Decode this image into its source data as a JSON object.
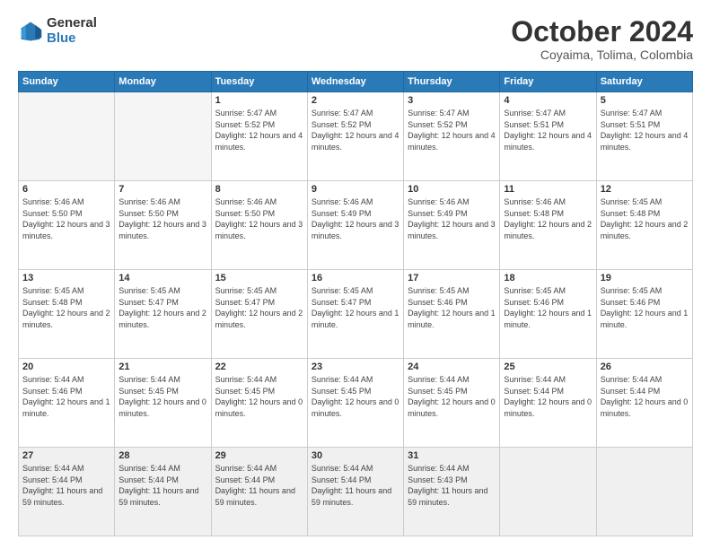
{
  "logo": {
    "general": "General",
    "blue": "Blue"
  },
  "header": {
    "month": "October 2024",
    "location": "Coyaima, Tolima, Colombia"
  },
  "weekdays": [
    "Sunday",
    "Monday",
    "Tuesday",
    "Wednesday",
    "Thursday",
    "Friday",
    "Saturday"
  ],
  "weeks": [
    [
      {
        "day": "",
        "info": ""
      },
      {
        "day": "",
        "info": ""
      },
      {
        "day": "1",
        "info": "Sunrise: 5:47 AM\nSunset: 5:52 PM\nDaylight: 12 hours and 4 minutes."
      },
      {
        "day": "2",
        "info": "Sunrise: 5:47 AM\nSunset: 5:52 PM\nDaylight: 12 hours and 4 minutes."
      },
      {
        "day": "3",
        "info": "Sunrise: 5:47 AM\nSunset: 5:52 PM\nDaylight: 12 hours and 4 minutes."
      },
      {
        "day": "4",
        "info": "Sunrise: 5:47 AM\nSunset: 5:51 PM\nDaylight: 12 hours and 4 minutes."
      },
      {
        "day": "5",
        "info": "Sunrise: 5:47 AM\nSunset: 5:51 PM\nDaylight: 12 hours and 4 minutes."
      }
    ],
    [
      {
        "day": "6",
        "info": "Sunrise: 5:46 AM\nSunset: 5:50 PM\nDaylight: 12 hours and 3 minutes."
      },
      {
        "day": "7",
        "info": "Sunrise: 5:46 AM\nSunset: 5:50 PM\nDaylight: 12 hours and 3 minutes."
      },
      {
        "day": "8",
        "info": "Sunrise: 5:46 AM\nSunset: 5:50 PM\nDaylight: 12 hours and 3 minutes."
      },
      {
        "day": "9",
        "info": "Sunrise: 5:46 AM\nSunset: 5:49 PM\nDaylight: 12 hours and 3 minutes."
      },
      {
        "day": "10",
        "info": "Sunrise: 5:46 AM\nSunset: 5:49 PM\nDaylight: 12 hours and 3 minutes."
      },
      {
        "day": "11",
        "info": "Sunrise: 5:46 AM\nSunset: 5:48 PM\nDaylight: 12 hours and 2 minutes."
      },
      {
        "day": "12",
        "info": "Sunrise: 5:45 AM\nSunset: 5:48 PM\nDaylight: 12 hours and 2 minutes."
      }
    ],
    [
      {
        "day": "13",
        "info": "Sunrise: 5:45 AM\nSunset: 5:48 PM\nDaylight: 12 hours and 2 minutes."
      },
      {
        "day": "14",
        "info": "Sunrise: 5:45 AM\nSunset: 5:47 PM\nDaylight: 12 hours and 2 minutes."
      },
      {
        "day": "15",
        "info": "Sunrise: 5:45 AM\nSunset: 5:47 PM\nDaylight: 12 hours and 2 minutes."
      },
      {
        "day": "16",
        "info": "Sunrise: 5:45 AM\nSunset: 5:47 PM\nDaylight: 12 hours and 1 minute."
      },
      {
        "day": "17",
        "info": "Sunrise: 5:45 AM\nSunset: 5:46 PM\nDaylight: 12 hours and 1 minute."
      },
      {
        "day": "18",
        "info": "Sunrise: 5:45 AM\nSunset: 5:46 PM\nDaylight: 12 hours and 1 minute."
      },
      {
        "day": "19",
        "info": "Sunrise: 5:45 AM\nSunset: 5:46 PM\nDaylight: 12 hours and 1 minute."
      }
    ],
    [
      {
        "day": "20",
        "info": "Sunrise: 5:44 AM\nSunset: 5:46 PM\nDaylight: 12 hours and 1 minute."
      },
      {
        "day": "21",
        "info": "Sunrise: 5:44 AM\nSunset: 5:45 PM\nDaylight: 12 hours and 0 minutes."
      },
      {
        "day": "22",
        "info": "Sunrise: 5:44 AM\nSunset: 5:45 PM\nDaylight: 12 hours and 0 minutes."
      },
      {
        "day": "23",
        "info": "Sunrise: 5:44 AM\nSunset: 5:45 PM\nDaylight: 12 hours and 0 minutes."
      },
      {
        "day": "24",
        "info": "Sunrise: 5:44 AM\nSunset: 5:45 PM\nDaylight: 12 hours and 0 minutes."
      },
      {
        "day": "25",
        "info": "Sunrise: 5:44 AM\nSunset: 5:44 PM\nDaylight: 12 hours and 0 minutes."
      },
      {
        "day": "26",
        "info": "Sunrise: 5:44 AM\nSunset: 5:44 PM\nDaylight: 12 hours and 0 minutes."
      }
    ],
    [
      {
        "day": "27",
        "info": "Sunrise: 5:44 AM\nSunset: 5:44 PM\nDaylight: 11 hours and 59 minutes."
      },
      {
        "day": "28",
        "info": "Sunrise: 5:44 AM\nSunset: 5:44 PM\nDaylight: 11 hours and 59 minutes."
      },
      {
        "day": "29",
        "info": "Sunrise: 5:44 AM\nSunset: 5:44 PM\nDaylight: 11 hours and 59 minutes."
      },
      {
        "day": "30",
        "info": "Sunrise: 5:44 AM\nSunset: 5:44 PM\nDaylight: 11 hours and 59 minutes."
      },
      {
        "day": "31",
        "info": "Sunrise: 5:44 AM\nSunset: 5:43 PM\nDaylight: 11 hours and 59 minutes."
      },
      {
        "day": "",
        "info": ""
      },
      {
        "day": "",
        "info": ""
      }
    ]
  ]
}
